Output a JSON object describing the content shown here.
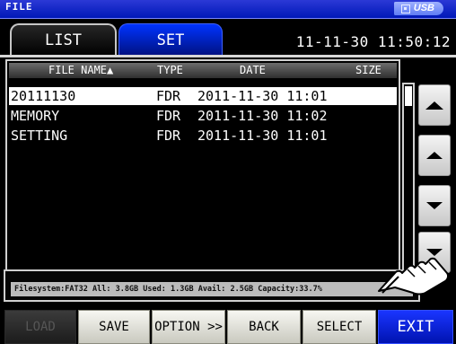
{
  "window": {
    "title": "FILE",
    "usb_label": "USB",
    "usb_icon": "media-icon"
  },
  "tabs": [
    {
      "label": "LIST",
      "active": true
    },
    {
      "label": "SET",
      "active": false
    }
  ],
  "clock": "11-11-30 11:50:12",
  "file_table": {
    "columns": [
      "FILE NAME▲",
      "TYPE",
      "DATE",
      "SIZE"
    ],
    "rows": [
      {
        "name": "20111130",
        "type": "FDR",
        "date": "2011-11-30 11:01",
        "size": "",
        "selected": true
      },
      {
        "name": "MEMORY",
        "type": "FDR",
        "date": "2011-11-30 11:02",
        "size": "",
        "selected": false
      },
      {
        "name": "SETTING",
        "type": "FDR",
        "date": "2011-11-30 11:01",
        "size": "",
        "selected": false
      }
    ]
  },
  "scroll_buttons": [
    "page-up-icon",
    "line-up-icon",
    "line-down-icon",
    "page-down-icon"
  ],
  "status": "Filesystem:FAT32 All: 3.8GB Used: 1.3GB Avail: 2.5GB Capacity:33.7%",
  "footer": {
    "buttons": [
      {
        "label": "LOAD",
        "enabled": false
      },
      {
        "label": "SAVE",
        "enabled": true
      },
      {
        "label": "OPTION >>",
        "enabled": true
      },
      {
        "label": "BACK",
        "enabled": true
      },
      {
        "label": "SELECT",
        "enabled": true
      },
      {
        "label": "EXIT",
        "enabled": true
      }
    ]
  },
  "colors": {
    "title_bar": "#0018b8",
    "tab_active": "#262626",
    "tab_inactive": "#0022cc",
    "exit_button": "#0013b0",
    "selection": "#ffffff"
  }
}
